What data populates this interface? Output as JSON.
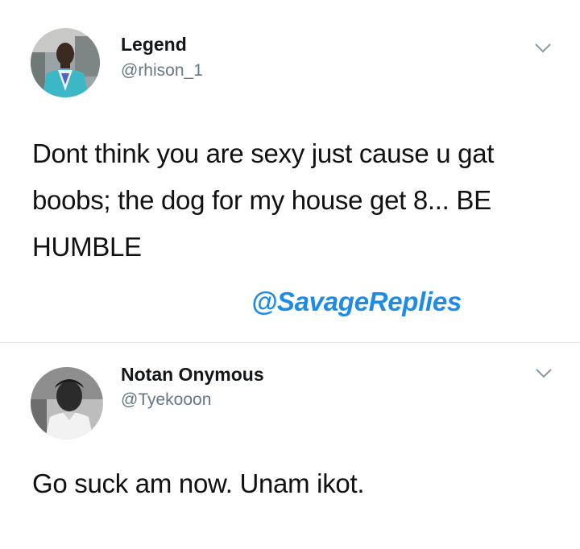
{
  "tweets": [
    {
      "display_name": "Legend",
      "handle": "@rhison_1",
      "text": "Dont think you are sexy just cause u gat boobs; the dog for my house get 8... BE HUMBLE",
      "menu_icon": "chevron-down-icon"
    },
    {
      "display_name": "Notan Onymous",
      "handle": "@Tyekooon",
      "text": "Go suck am now. Unam ikot.",
      "menu_icon": "chevron-down-icon"
    }
  ],
  "watermark": "@SavageReplies",
  "colors": {
    "watermark": "#1e8ce6",
    "handle": "#657786",
    "divider": "#e1e8ed"
  }
}
